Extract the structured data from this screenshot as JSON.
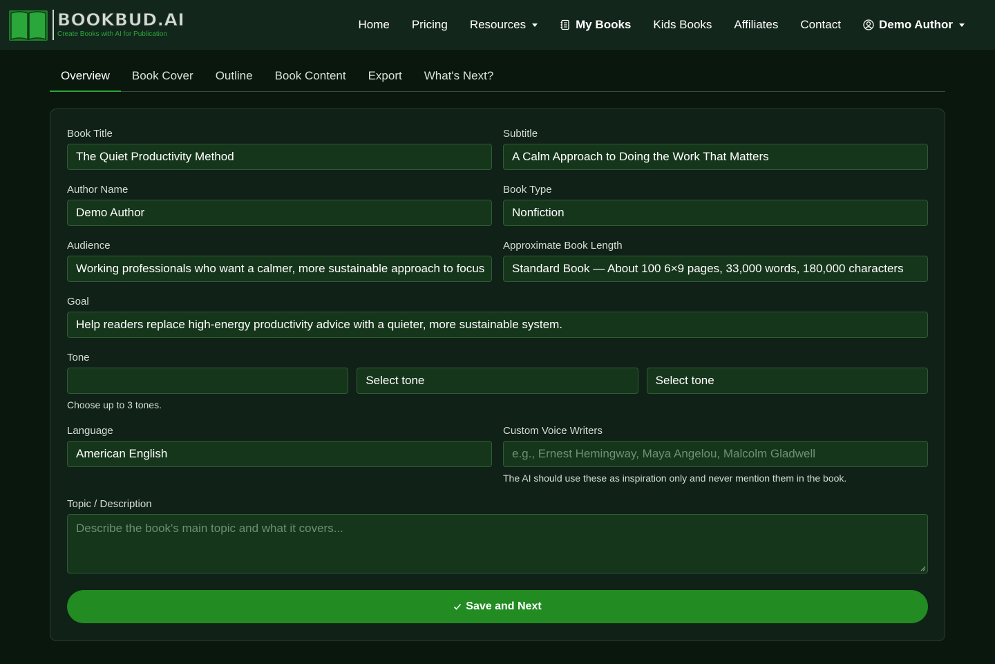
{
  "brand": {
    "name": "BOOKBUD.AI",
    "tagline": "Create Books with AI for Publication"
  },
  "nav": {
    "home": "Home",
    "pricing": "Pricing",
    "resources": "Resources",
    "my_books": "My Books",
    "kids_books": "Kids Books",
    "affiliates": "Affiliates",
    "contact": "Contact",
    "user": "Demo Author"
  },
  "tabs": [
    "Overview",
    "Book Cover",
    "Outline",
    "Book Content",
    "Export",
    "What's Next?"
  ],
  "form": {
    "book_title": {
      "label": "Book Title",
      "value": "The Quiet Productivity Method"
    },
    "subtitle": {
      "label": "Subtitle",
      "value": "A Calm Approach to Doing the Work That Matters"
    },
    "author_name": {
      "label": "Author Name",
      "value": "Demo Author"
    },
    "book_type": {
      "label": "Book Type",
      "value": "Nonfiction"
    },
    "audience": {
      "label": "Audience",
      "value": "Working professionals who want a calmer, more sustainable approach to focus"
    },
    "book_length": {
      "label": "Approximate Book Length",
      "value": "Standard Book — About 100 6×9 pages, 33,000 words, 180,000 characters"
    },
    "goal": {
      "label": "Goal",
      "value": "Help readers replace high-energy productivity advice with a quieter, more sustainable system."
    },
    "tone": {
      "label": "Tone",
      "values": [
        "",
        "Select tone",
        "Select tone"
      ],
      "hint": "Choose up to 3 tones."
    },
    "language": {
      "label": "Language",
      "value": "American English"
    },
    "voice_writers": {
      "label": "Custom Voice Writers",
      "placeholder": "e.g., Ernest Hemingway, Maya Angelou, Malcolm Gladwell",
      "hint": "The AI should use these as inspiration only and never mention them in the book."
    },
    "topic": {
      "label": "Topic / Description",
      "placeholder": "Describe the book's main topic and what it covers..."
    },
    "save_label": "Save and Next"
  },
  "colors": {
    "accent": "#228b22",
    "navbar_bg": "#13261c",
    "page_bg": "#0a170d",
    "field_bg": "#16361c"
  }
}
